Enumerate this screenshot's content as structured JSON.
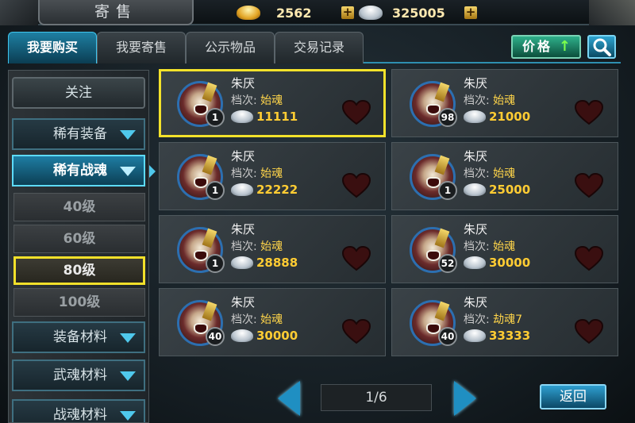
{
  "header": {
    "title": "寄售",
    "gold": "2562",
    "silver": "325005",
    "gold_icon": "gold-ingot-icon",
    "silver_icon": "silver-ingot-icon"
  },
  "tabs": [
    {
      "label": "我要购买",
      "active": true
    },
    {
      "label": "我要寄售",
      "active": false
    },
    {
      "label": "公示物品",
      "active": false
    },
    {
      "label": "交易记录",
      "active": false
    }
  ],
  "toolbar": {
    "sort_label": "价格",
    "sort_icon": "arrow-up-icon",
    "search_icon": "search-icon"
  },
  "sidebar": {
    "follow": "关注",
    "categories": [
      {
        "label": "稀有装备"
      },
      {
        "label": "稀有战魂"
      }
    ],
    "levels": [
      {
        "label": "40级"
      },
      {
        "label": "60级"
      },
      {
        "label": "80级",
        "selected": true
      },
      {
        "label": "100级"
      }
    ],
    "more": [
      {
        "label": "装备材料"
      },
      {
        "label": "武魂材料"
      },
      {
        "label": "战魂材料"
      }
    ]
  },
  "items": [
    {
      "name": "朱厌",
      "grade_label": "档次:",
      "grade": "始魂",
      "level": "1",
      "price": "11111",
      "selected": true
    },
    {
      "name": "朱厌",
      "grade_label": "档次:",
      "grade": "始魂",
      "level": "98",
      "price": "21000"
    },
    {
      "name": "朱厌",
      "grade_label": "档次:",
      "grade": "始魂",
      "level": "1",
      "price": "22222"
    },
    {
      "name": "朱厌",
      "grade_label": "档次:",
      "grade": "始魂",
      "level": "1",
      "price": "25000"
    },
    {
      "name": "朱厌",
      "grade_label": "档次:",
      "grade": "始魂",
      "level": "1",
      "price": "28888"
    },
    {
      "name": "朱厌",
      "grade_label": "档次:",
      "grade": "始魂",
      "level": "52",
      "price": "30000"
    },
    {
      "name": "朱厌",
      "grade_label": "档次:",
      "grade": "始魂",
      "level": "40",
      "price": "30000"
    },
    {
      "name": "朱厌",
      "grade_label": "档次:",
      "grade": "劫魂7",
      "level": "40",
      "price": "33333"
    }
  ],
  "pager": {
    "text": "1/6"
  },
  "back_label": "返回",
  "colors": {
    "accent": "#1f8fc2",
    "highlight": "#f3e22b",
    "price": "#ffcc33"
  }
}
